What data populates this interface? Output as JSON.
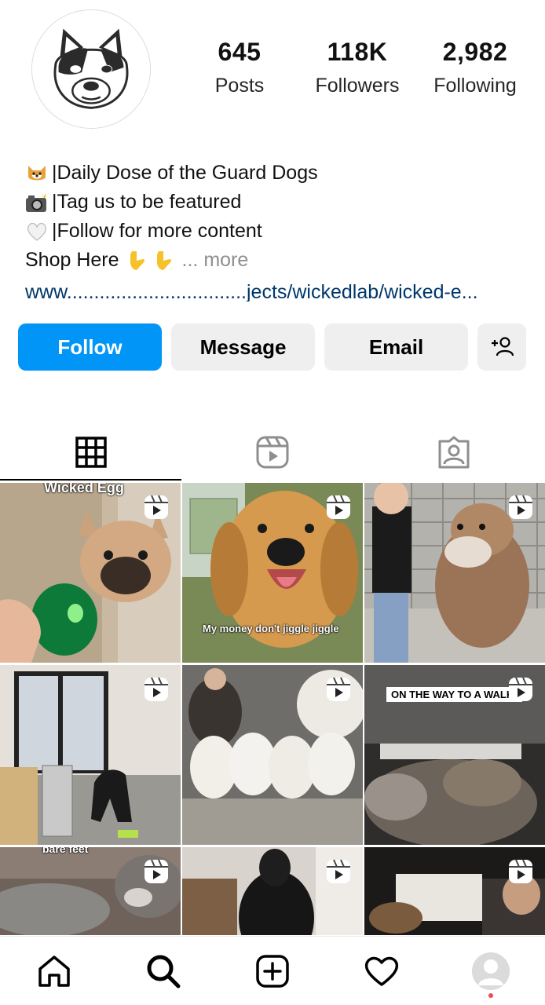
{
  "profile": {
    "stats": [
      {
        "value": "645",
        "label": "Posts"
      },
      {
        "value": "118K",
        "label": "Followers"
      },
      {
        "value": "2,982",
        "label": "Following"
      }
    ],
    "bio": {
      "line1": "|Daily Dose of the Guard Dogs",
      "line2": "|Tag us to be featured",
      "line3": "|Follow for more content",
      "line4": "Shop Here",
      "more": "... more",
      "link": "www.................................jects/wickedlab/wicked-e..."
    }
  },
  "actions": {
    "follow": "Follow",
    "message": "Message",
    "email": "Email"
  },
  "grid": {
    "captions": {
      "post1_top": "Wicked Egg",
      "post2": "My money don't jiggle jiggle",
      "post6": "ON THE WAY TO A WALK:",
      "post7_top": "bare feet"
    }
  },
  "colors": {
    "primary": "#0095f6",
    "secondary_button": "#efefef",
    "notification_dot": "#ed4956"
  },
  "icons": {
    "tabs": [
      "grid-icon",
      "reels-icon",
      "tagged-icon"
    ],
    "nav": [
      "home-icon",
      "search-icon",
      "create-icon",
      "heart-icon",
      "profile-avatar"
    ]
  }
}
